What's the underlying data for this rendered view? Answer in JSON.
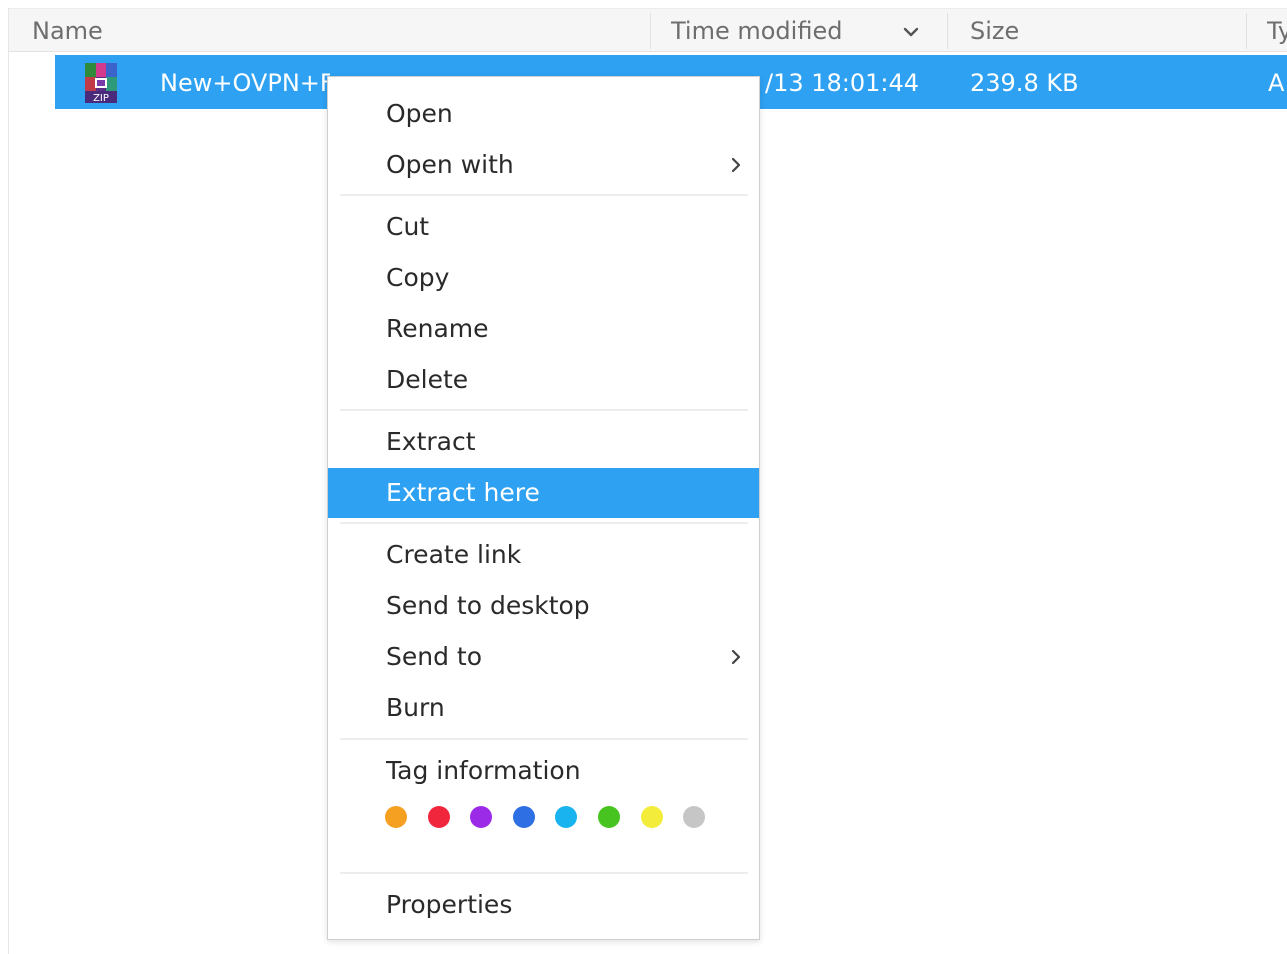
{
  "table": {
    "columns": {
      "name": "Name",
      "time_modified": "Time modified",
      "size": "Size",
      "type": "Ty"
    },
    "selected_row": {
      "name": "New+OVPN+Fi",
      "time_modified": "/13 18:01:44",
      "size": "239.8 KB",
      "type": "A",
      "icon": "zip-archive-icon"
    }
  },
  "context_menu": {
    "items": [
      {
        "label": "Open"
      },
      {
        "label": "Open with",
        "submenu": true
      },
      {
        "label": "Cut"
      },
      {
        "label": "Copy"
      },
      {
        "label": "Rename"
      },
      {
        "label": "Delete"
      },
      {
        "label": "Extract"
      },
      {
        "label": "Extract here",
        "highlighted": true
      },
      {
        "label": "Create link"
      },
      {
        "label": "Send to desktop"
      },
      {
        "label": "Send to",
        "submenu": true
      },
      {
        "label": "Burn"
      },
      {
        "label": "Tag information"
      },
      {
        "label": "Properties"
      }
    ],
    "tag_colors": [
      {
        "name": "orange",
        "color": "#f5a021"
      },
      {
        "name": "red",
        "color": "#f0263d"
      },
      {
        "name": "purple",
        "color": "#9c2be8"
      },
      {
        "name": "blue",
        "color": "#2e6fe3"
      },
      {
        "name": "light-blue",
        "color": "#19b3ef"
      },
      {
        "name": "green",
        "color": "#47c41f"
      },
      {
        "name": "yellow",
        "color": "#f4ec3a"
      },
      {
        "name": "gray",
        "color": "#c6c6c6"
      }
    ]
  },
  "colors": {
    "selection": "#2ea1f2"
  }
}
